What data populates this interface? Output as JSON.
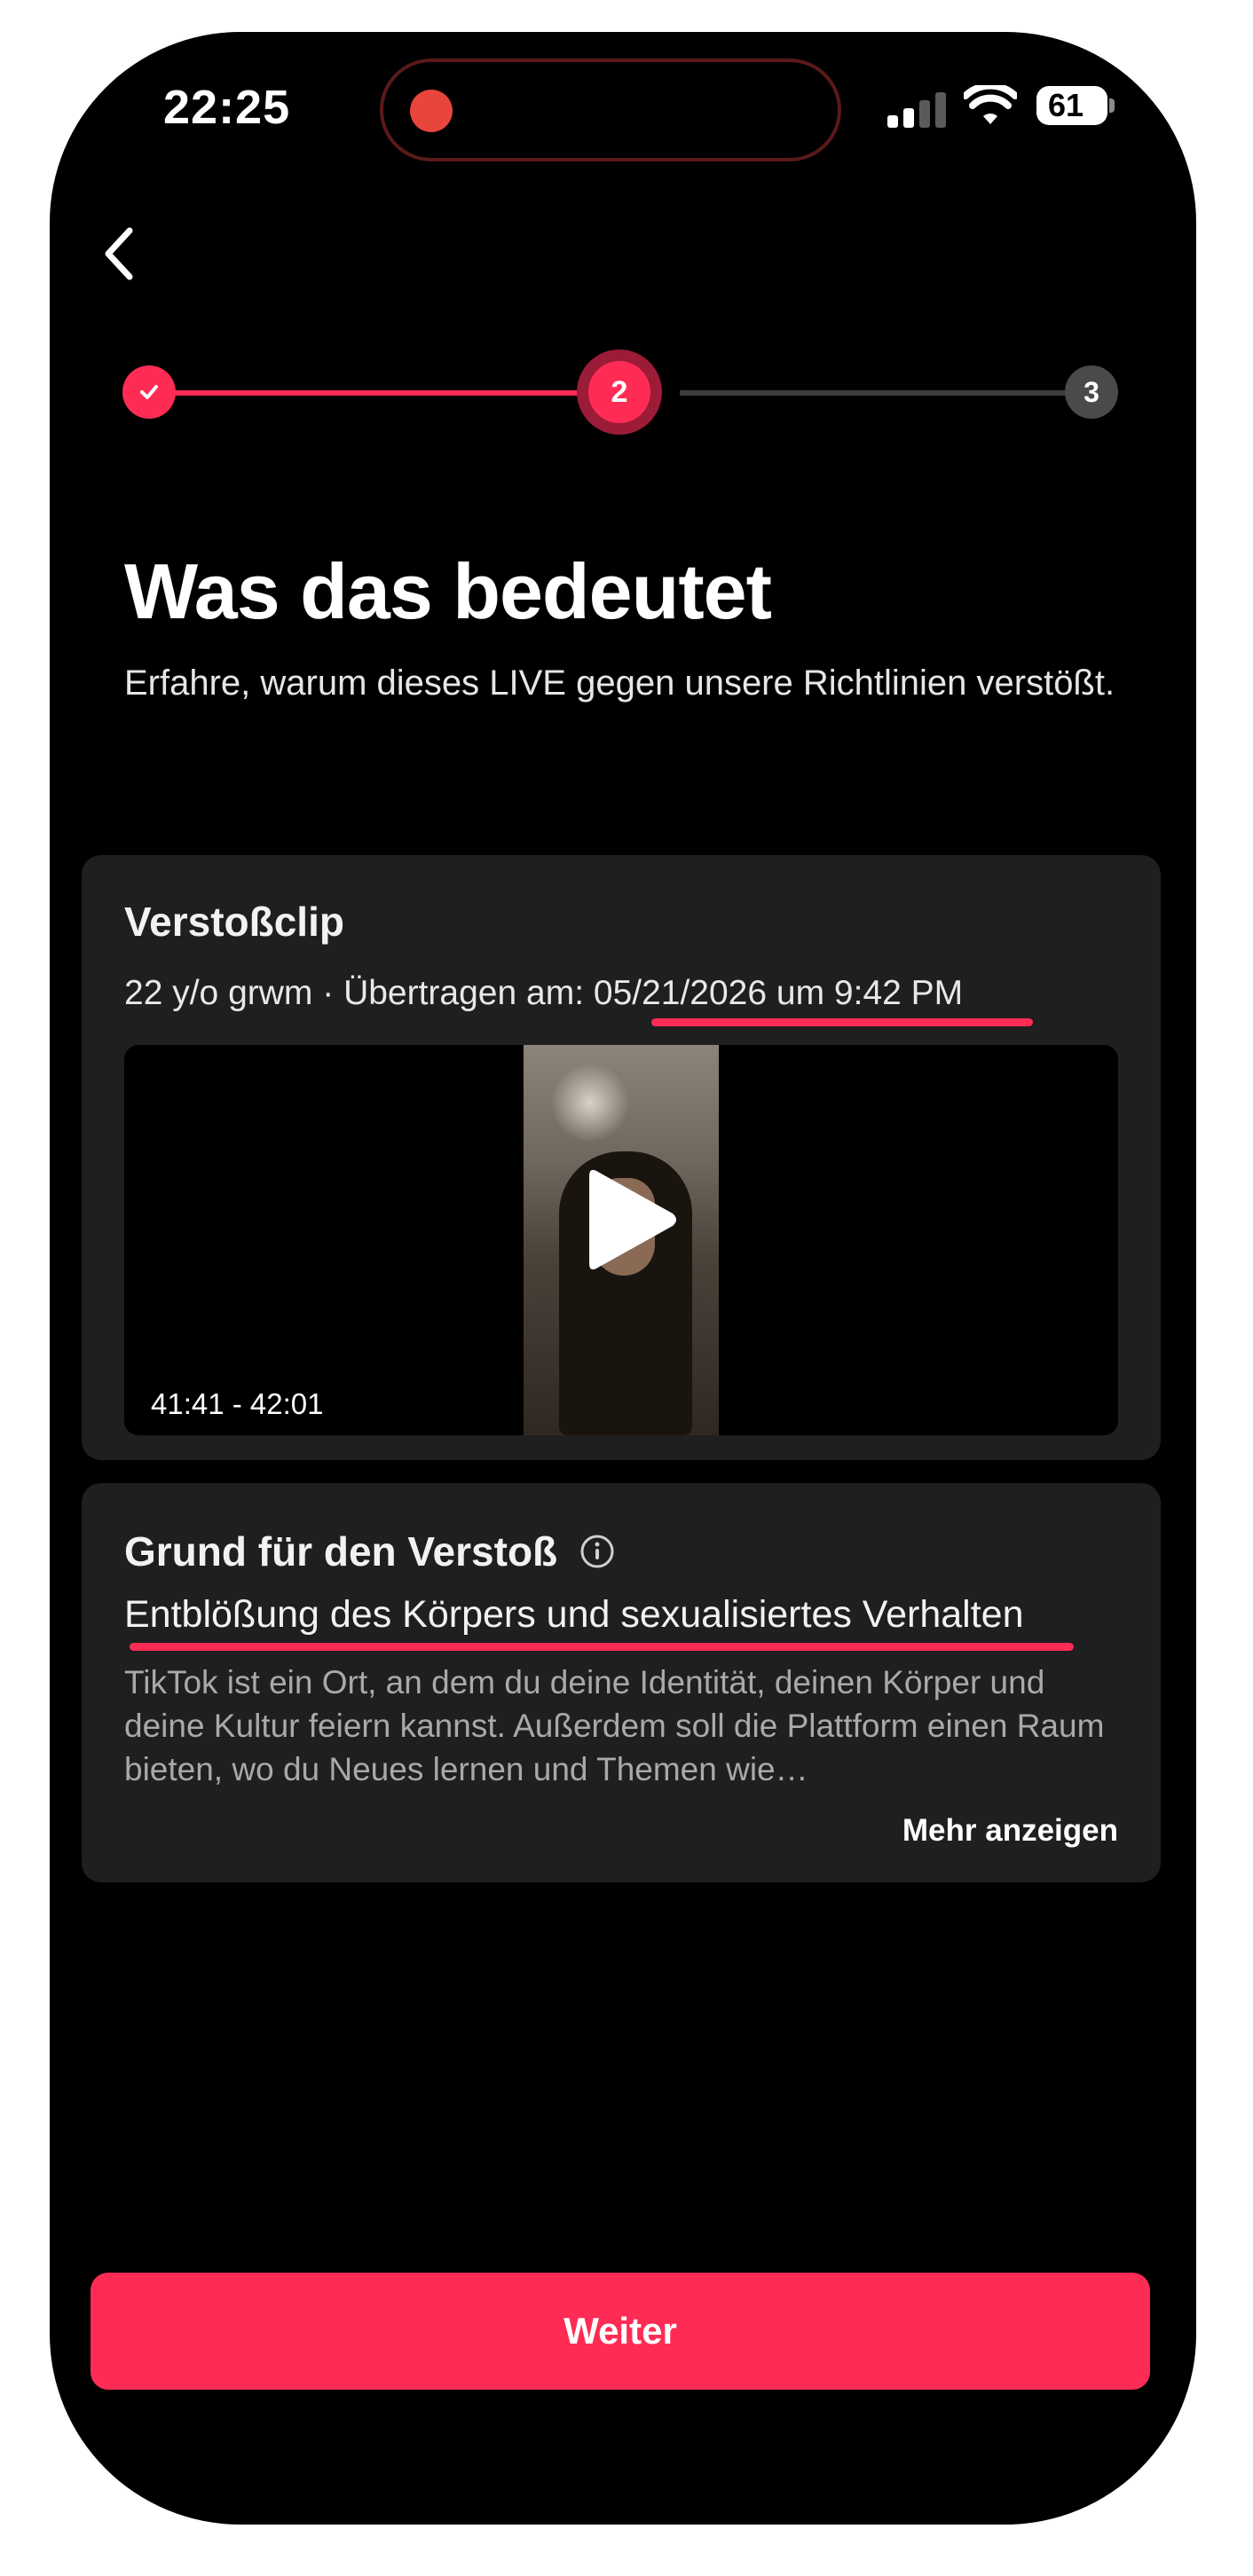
{
  "status_bar": {
    "time": "22:25",
    "battery": "61"
  },
  "stepper": {
    "current_step": "2",
    "last_step": "3"
  },
  "header": {
    "title": "Was das bedeutet",
    "subtitle": "Erfahre, warum dieses LIVE gegen unsere Richtlinien verstößt."
  },
  "clip_card": {
    "title": "Verstoßclip",
    "meta_prefix": "22 y/o grwm · Übertragen am: ",
    "meta_date": "05/21/2026 um 9:42 PM",
    "timestamp": "41:41 - 42:01"
  },
  "reason_card": {
    "title": "Grund für den Verstoß",
    "reason": "Entblößung des Körpers und sexualisiertes Verhalten",
    "description": "TikTok ist ein Ort, an dem du deine Identität, deinen Körper und deine Kultur feiern kannst. Außerdem soll die Plattform einen Raum bieten, wo du Neues lernen und Themen wie…",
    "more_label": "Mehr anzeigen"
  },
  "footer": {
    "button_label": "Weiter"
  },
  "colors": {
    "accent": "#fe2c55",
    "background": "#000000",
    "card": "#1f1f1f"
  }
}
